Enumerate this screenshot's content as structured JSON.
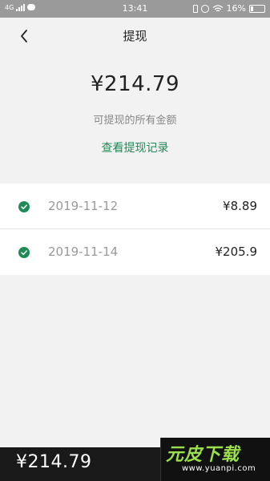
{
  "status_bar": {
    "network": "4G",
    "time": "13:41",
    "battery": "16%"
  },
  "nav": {
    "title": "提现"
  },
  "summary": {
    "amount": "¥214.79",
    "caption": "可提现的所有金额",
    "record_link": "查看提现记录"
  },
  "records": [
    {
      "date": "2019-11-12",
      "amount": "¥8.89"
    },
    {
      "date": "2019-11-14",
      "amount": "¥205.9"
    }
  ],
  "bottom_bar": {
    "amount": "¥214.79"
  },
  "watermark": {
    "logo": "元皮下载",
    "url": "www.yuanpi.com"
  },
  "colors": {
    "accent": "#1f8a55",
    "status_bar": "#9a9a9a",
    "bottom_bar": "#1a1a1a"
  }
}
